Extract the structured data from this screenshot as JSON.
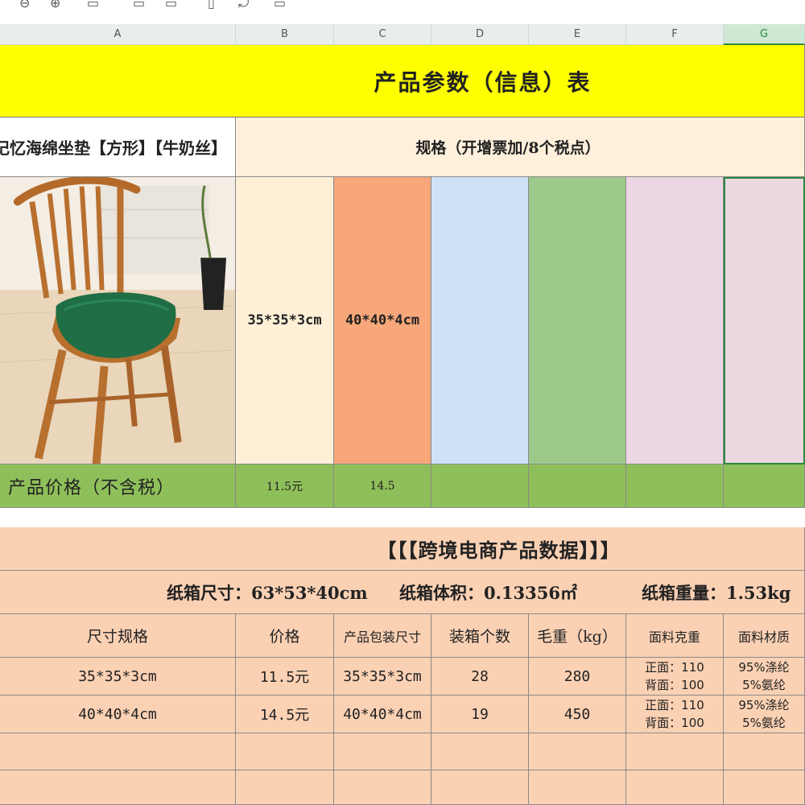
{
  "columns": [
    "A",
    "B",
    "C",
    "D",
    "E",
    "F",
    "G"
  ],
  "selected_column": "G",
  "colors": {
    "title_band": "#ffff00",
    "price_row": "#8fbf5a",
    "cross_border_section": "#fbd1b4",
    "spec_swatches": [
      "#fdf0d6",
      "#f7a77a",
      "#cfe1f4",
      "#9dc98a",
      "#ecd6e3",
      "#ecd6e0"
    ]
  },
  "header": {
    "title": "产品参数（信息）表"
  },
  "product": {
    "name": "记忆海绵坐垫【方形】【牛奶丝】",
    "image_alt": "wooden chair with green square seat cushion"
  },
  "spec": {
    "header": "规格（开增票加/8个税点）",
    "sizes": [
      "35*35*3cm",
      "40*40*4cm",
      "",
      "",
      "",
      ""
    ]
  },
  "price": {
    "label": "产品价格（不含税）",
    "values": [
      "11.5元",
      "14.5",
      "",
      "",
      "",
      ""
    ]
  },
  "cross_border": {
    "title": "【【【跨境电商产品数据】】】",
    "carton_size": "纸箱尺寸：63*53*40cm",
    "carton_volume": "纸箱体积：0.13356㎡",
    "carton_weight": "纸箱重量：1.53kg",
    "table_headers": [
      "尺寸规格",
      "价格",
      "产品包装尺寸",
      "装箱个数",
      "毛重（kg）",
      "面料克重",
      "面料材质"
    ],
    "rows": [
      {
        "size": "35*35*3cm",
        "price": "11.5元",
        "package": "35*35*3cm",
        "count": "28",
        "gross": "280",
        "weight_front": "正面：110",
        "weight_back": "背面：100",
        "material_1": "95%涤纶",
        "material_2": "5%氨纶"
      },
      {
        "size": "40*40*4cm",
        "price": "14.5元",
        "package": "40*40*4cm",
        "count": "19",
        "gross": "450",
        "weight_front": "正面：110",
        "weight_back": "背面：100",
        "material_1": "95%涤纶",
        "material_2": "5%氨纶"
      }
    ]
  }
}
